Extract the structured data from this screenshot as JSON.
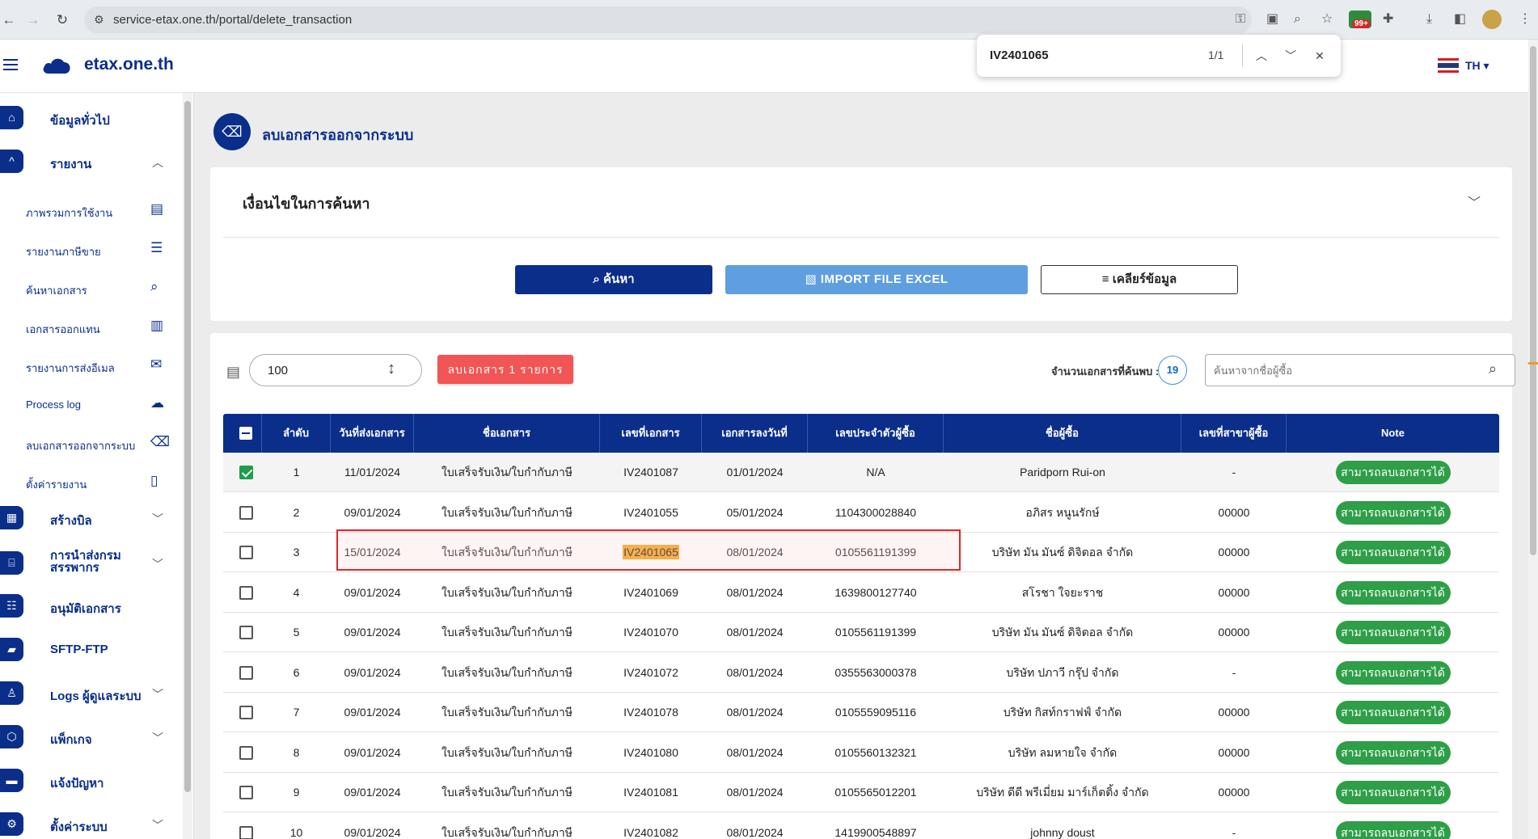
{
  "browser": {
    "url": "service-etax.one.th/portal/delete_transaction",
    "ext_badge": "99+"
  },
  "find_bar": {
    "query": "IV2401065",
    "count": "1/1"
  },
  "header": {
    "brand": "etax.one.th",
    "language": "TH"
  },
  "sidebar": {
    "main_items": [
      {
        "label": "ข้อมูลทั่วไป",
        "icon": "home-icon"
      },
      {
        "label": "รายงาน",
        "icon": "chevron-up-icon"
      },
      {
        "label": "สร้างบิล",
        "icon": "bill-icon"
      },
      {
        "label": "การนำส่งกรม\nสรรพากร",
        "icon": "bank-icon"
      },
      {
        "label": "อนุมัติเอกสาร",
        "icon": "approve-icon"
      },
      {
        "label": "SFTP-FTP",
        "icon": "folder-icon"
      },
      {
        "label": "Logs ผู้ดูแลระบบ",
        "icon": "user-icon"
      },
      {
        "label": "แพ็กเกจ",
        "icon": "package-icon"
      },
      {
        "label": "แจ้งปัญหา",
        "icon": "chat-icon"
      },
      {
        "label": "ตั้งค่าระบบ",
        "icon": "settings-icon"
      }
    ],
    "sub_items": [
      {
        "label": "ภาพรวมการใช้งาน",
        "icon": "chart-doc-icon"
      },
      {
        "label": "รายงานภาษีขาย",
        "icon": "doc-lines-icon"
      },
      {
        "label": "ค้นหาเอกสาร",
        "icon": "doc-search-icon"
      },
      {
        "label": "เอกสารออกแทน",
        "icon": "clipboard-icon"
      },
      {
        "label": "รายงานการส่งอีเมล",
        "icon": "mail-alert-icon"
      },
      {
        "label": "Process log",
        "icon": "cloud-search-icon"
      },
      {
        "label": "ลบเอกสารออกจากระบบ",
        "icon": "trash-icon"
      },
      {
        "label": "ตั้งค่ารายงาน",
        "icon": "file-icon"
      }
    ]
  },
  "page": {
    "title": "ลบเอกสารออกจากระบบ"
  },
  "filter": {
    "title": "เงื่อนไขในการค้นหา",
    "search_button": "ค้นหา",
    "import_button": "IMPORT FILE EXCEL",
    "clear_button": "เคลียร์ข้อมูล"
  },
  "toolbar": {
    "page_size": "100",
    "delete_button": "ลบเอกสาร 1 รายการ",
    "count_label": "จำนวนเอกสารที่ค้นพบ :",
    "count_value": "19",
    "search_placeholder": "ค้นหาจากชื่อผู้ซื้อ"
  },
  "table": {
    "headers": [
      "ลำดับ",
      "วันที่ส่งเอกสาร",
      "ชื่อเอกสาร",
      "เลขที่เอกสาร",
      "เอกสารลงวันที่",
      "เลขประจำตัวผู้ซื้อ",
      "ชื่อผู้ซื้อ",
      "เลขที่สาขาผู้ซื้อ",
      "Note"
    ],
    "note_label": "สามารถลบเอกสารได้",
    "rows": [
      {
        "checked": true,
        "no": "1",
        "sent": "11/01/2024",
        "doc_name": "ใบเสร็จรับเงิน/ใบกำกับภาษี",
        "doc_no": "IV2401087",
        "doc_date": "01/01/2024",
        "tax_id": "N/A",
        "buyer": "Paridporn Rui-on",
        "branch": "-"
      },
      {
        "checked": false,
        "no": "2",
        "sent": "09/01/2024",
        "doc_name": "ใบเสร็จรับเงิน/ใบกำกับภาษี",
        "doc_no": "IV2401055",
        "doc_date": "05/01/2024",
        "tax_id": "1104300028840",
        "buyer": "อภิสร หนูนรักษ์",
        "branch": "00000"
      },
      {
        "checked": false,
        "no": "3",
        "sent": "15/01/2024",
        "doc_name": "ใบเสร็จรับเงิน/ใบกำกับภาษี",
        "doc_no": "IV2401065",
        "doc_date": "08/01/2024",
        "tax_id": "0105561191399",
        "buyer": "บริษัท มัน มันซ์ ดิจิตอล จำกัด",
        "branch": "00000"
      },
      {
        "checked": false,
        "no": "4",
        "sent": "09/01/2024",
        "doc_name": "ใบเสร็จรับเงิน/ใบกำกับภาษี",
        "doc_no": "IV2401069",
        "doc_date": "08/01/2024",
        "tax_id": "1639800127740",
        "buyer": "สโรชา ใจยะราช",
        "branch": "00000"
      },
      {
        "checked": false,
        "no": "5",
        "sent": "09/01/2024",
        "doc_name": "ใบเสร็จรับเงิน/ใบกำกับภาษี",
        "doc_no": "IV2401070",
        "doc_date": "08/01/2024",
        "tax_id": "0105561191399",
        "buyer": "บริษัท มัน มันซ์ ดิจิตอล จำกัด",
        "branch": "00000"
      },
      {
        "checked": false,
        "no": "6",
        "sent": "09/01/2024",
        "doc_name": "ใบเสร็จรับเงิน/ใบกำกับภาษี",
        "doc_no": "IV2401072",
        "doc_date": "08/01/2024",
        "tax_id": "0355563000378",
        "buyer": "บริษัท ปภาวี กรุ๊ป จำกัด",
        "branch": "-"
      },
      {
        "checked": false,
        "no": "7",
        "sent": "09/01/2024",
        "doc_name": "ใบเสร็จรับเงิน/ใบกำกับภาษี",
        "doc_no": "IV2401078",
        "doc_date": "08/01/2024",
        "tax_id": "0105559095116",
        "buyer": "บริษัท กิสท์กราฟฟ์ จำกัด",
        "branch": "00000"
      },
      {
        "checked": false,
        "no": "8",
        "sent": "09/01/2024",
        "doc_name": "ใบเสร็จรับเงิน/ใบกำกับภาษี",
        "doc_no": "IV2401080",
        "doc_date": "08/01/2024",
        "tax_id": "0105560132321",
        "buyer": "บริษัท ลมหายใจ จำกัด",
        "branch": "00000"
      },
      {
        "checked": false,
        "no": "9",
        "sent": "09/01/2024",
        "doc_name": "ใบเสร็จรับเงิน/ใบกำกับภาษี",
        "doc_no": "IV2401081",
        "doc_date": "08/01/2024",
        "tax_id": "0105565012201",
        "buyer": "บริษัท ดีดี พรีเมี่ยม มาร์เก็ตติ้ง จำกัด",
        "branch": "00000"
      },
      {
        "checked": false,
        "no": "10",
        "sent": "09/01/2024",
        "doc_name": "ใบเสร็จรับเงิน/ใบกำกับภาษี",
        "doc_no": "IV2401082",
        "doc_date": "08/01/2024",
        "tax_id": "1419900548897",
        "buyer": "johnny doust",
        "branch": "-"
      }
    ]
  }
}
